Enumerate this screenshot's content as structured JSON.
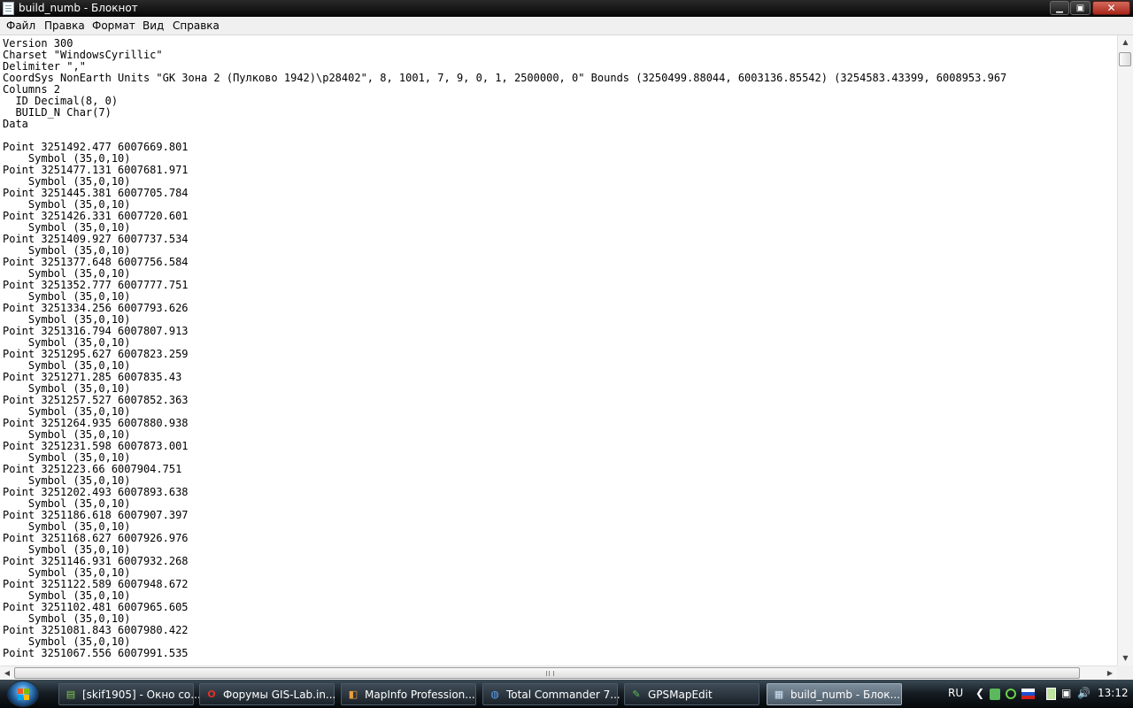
{
  "window": {
    "title": "build_numb - Блокнот",
    "min_glyph": "▁",
    "max_glyph": "▣",
    "close_glyph": "✕"
  },
  "menu": {
    "file": "Файл",
    "edit": "Правка",
    "format": "Формат",
    "view": "Вид",
    "help": "Справка"
  },
  "editor": {
    "content": "Version 300\nCharset \"WindowsCyrillic\"\nDelimiter \",\"\nCoordSys NonEarth Units \"GK Зона 2 (Пулково 1942)\\p28402\", 8, 1001, 7, 9, 0, 1, 2500000, 0\" Bounds (3250499.88044, 6003136.85542) (3254583.43399, 6008953.967\nColumns 2\n  ID Decimal(8, 0)\n  BUILD_N Char(7)\nData\n\nPoint 3251492.477 6007669.801\n    Symbol (35,0,10)\nPoint 3251477.131 6007681.971\n    Symbol (35,0,10)\nPoint 3251445.381 6007705.784\n    Symbol (35,0,10)\nPoint 3251426.331 6007720.601\n    Symbol (35,0,10)\nPoint 3251409.927 6007737.534\n    Symbol (35,0,10)\nPoint 3251377.648 6007756.584\n    Symbol (35,0,10)\nPoint 3251352.777 6007777.751\n    Symbol (35,0,10)\nPoint 3251334.256 6007793.626\n    Symbol (35,0,10)\nPoint 3251316.794 6007807.913\n    Symbol (35,0,10)\nPoint 3251295.627 6007823.259\n    Symbol (35,0,10)\nPoint 3251271.285 6007835.43\n    Symbol (35,0,10)\nPoint 3251257.527 6007852.363\n    Symbol (35,0,10)\nPoint 3251264.935 6007880.938\n    Symbol (35,0,10)\nPoint 3251231.598 6007873.001\n    Symbol (35,0,10)\nPoint 3251223.66 6007904.751\n    Symbol (35,0,10)\nPoint 3251202.493 6007893.638\n    Symbol (35,0,10)\nPoint 3251186.618 6007907.397\n    Symbol (35,0,10)\nPoint 3251168.627 6007926.976\n    Symbol (35,0,10)\nPoint 3251146.931 6007932.268\n    Symbol (35,0,10)\nPoint 3251122.589 6007948.672\n    Symbol (35,0,10)\nPoint 3251102.481 6007965.605\n    Symbol (35,0,10)\nPoint 3251081.843 6007980.422\n    Symbol (35,0,10)\nPoint 3251067.556 6007991.535"
  },
  "scrollbars": {
    "up_glyph": "▲",
    "down_glyph": "▼",
    "left_glyph": "◀",
    "right_glyph": "▶"
  },
  "taskbar": {
    "items": [
      {
        "label": "[skif1905] - Окно со...",
        "icon": "chat-window-icon",
        "glyph": "▤",
        "color": "#7ec850"
      },
      {
        "label": "Форумы GIS-Lab.in...",
        "icon": "opera-browser-icon",
        "glyph": "O",
        "color": "#e0302a"
      },
      {
        "label": "MapInfo Profession...",
        "icon": "mapinfo-icon",
        "glyph": "◧",
        "color": "#e8a040"
      },
      {
        "label": "Total Commander 7...",
        "icon": "total-commander-icon",
        "glyph": "◍",
        "color": "#5aa0e8"
      },
      {
        "label": "GPSMapEdit",
        "icon": "gpsmapedit-icon",
        "glyph": "✎",
        "color": "#5cc05c"
      },
      {
        "label": "build_numb - Блок...",
        "icon": "notepad-icon",
        "glyph": "▦",
        "color": "#cfe4f7"
      }
    ],
    "tray": {
      "language": "RU",
      "time": "13:12",
      "expand_glyph": "❮",
      "volume_glyph": "🔊",
      "network_glyph": "▣"
    }
  }
}
